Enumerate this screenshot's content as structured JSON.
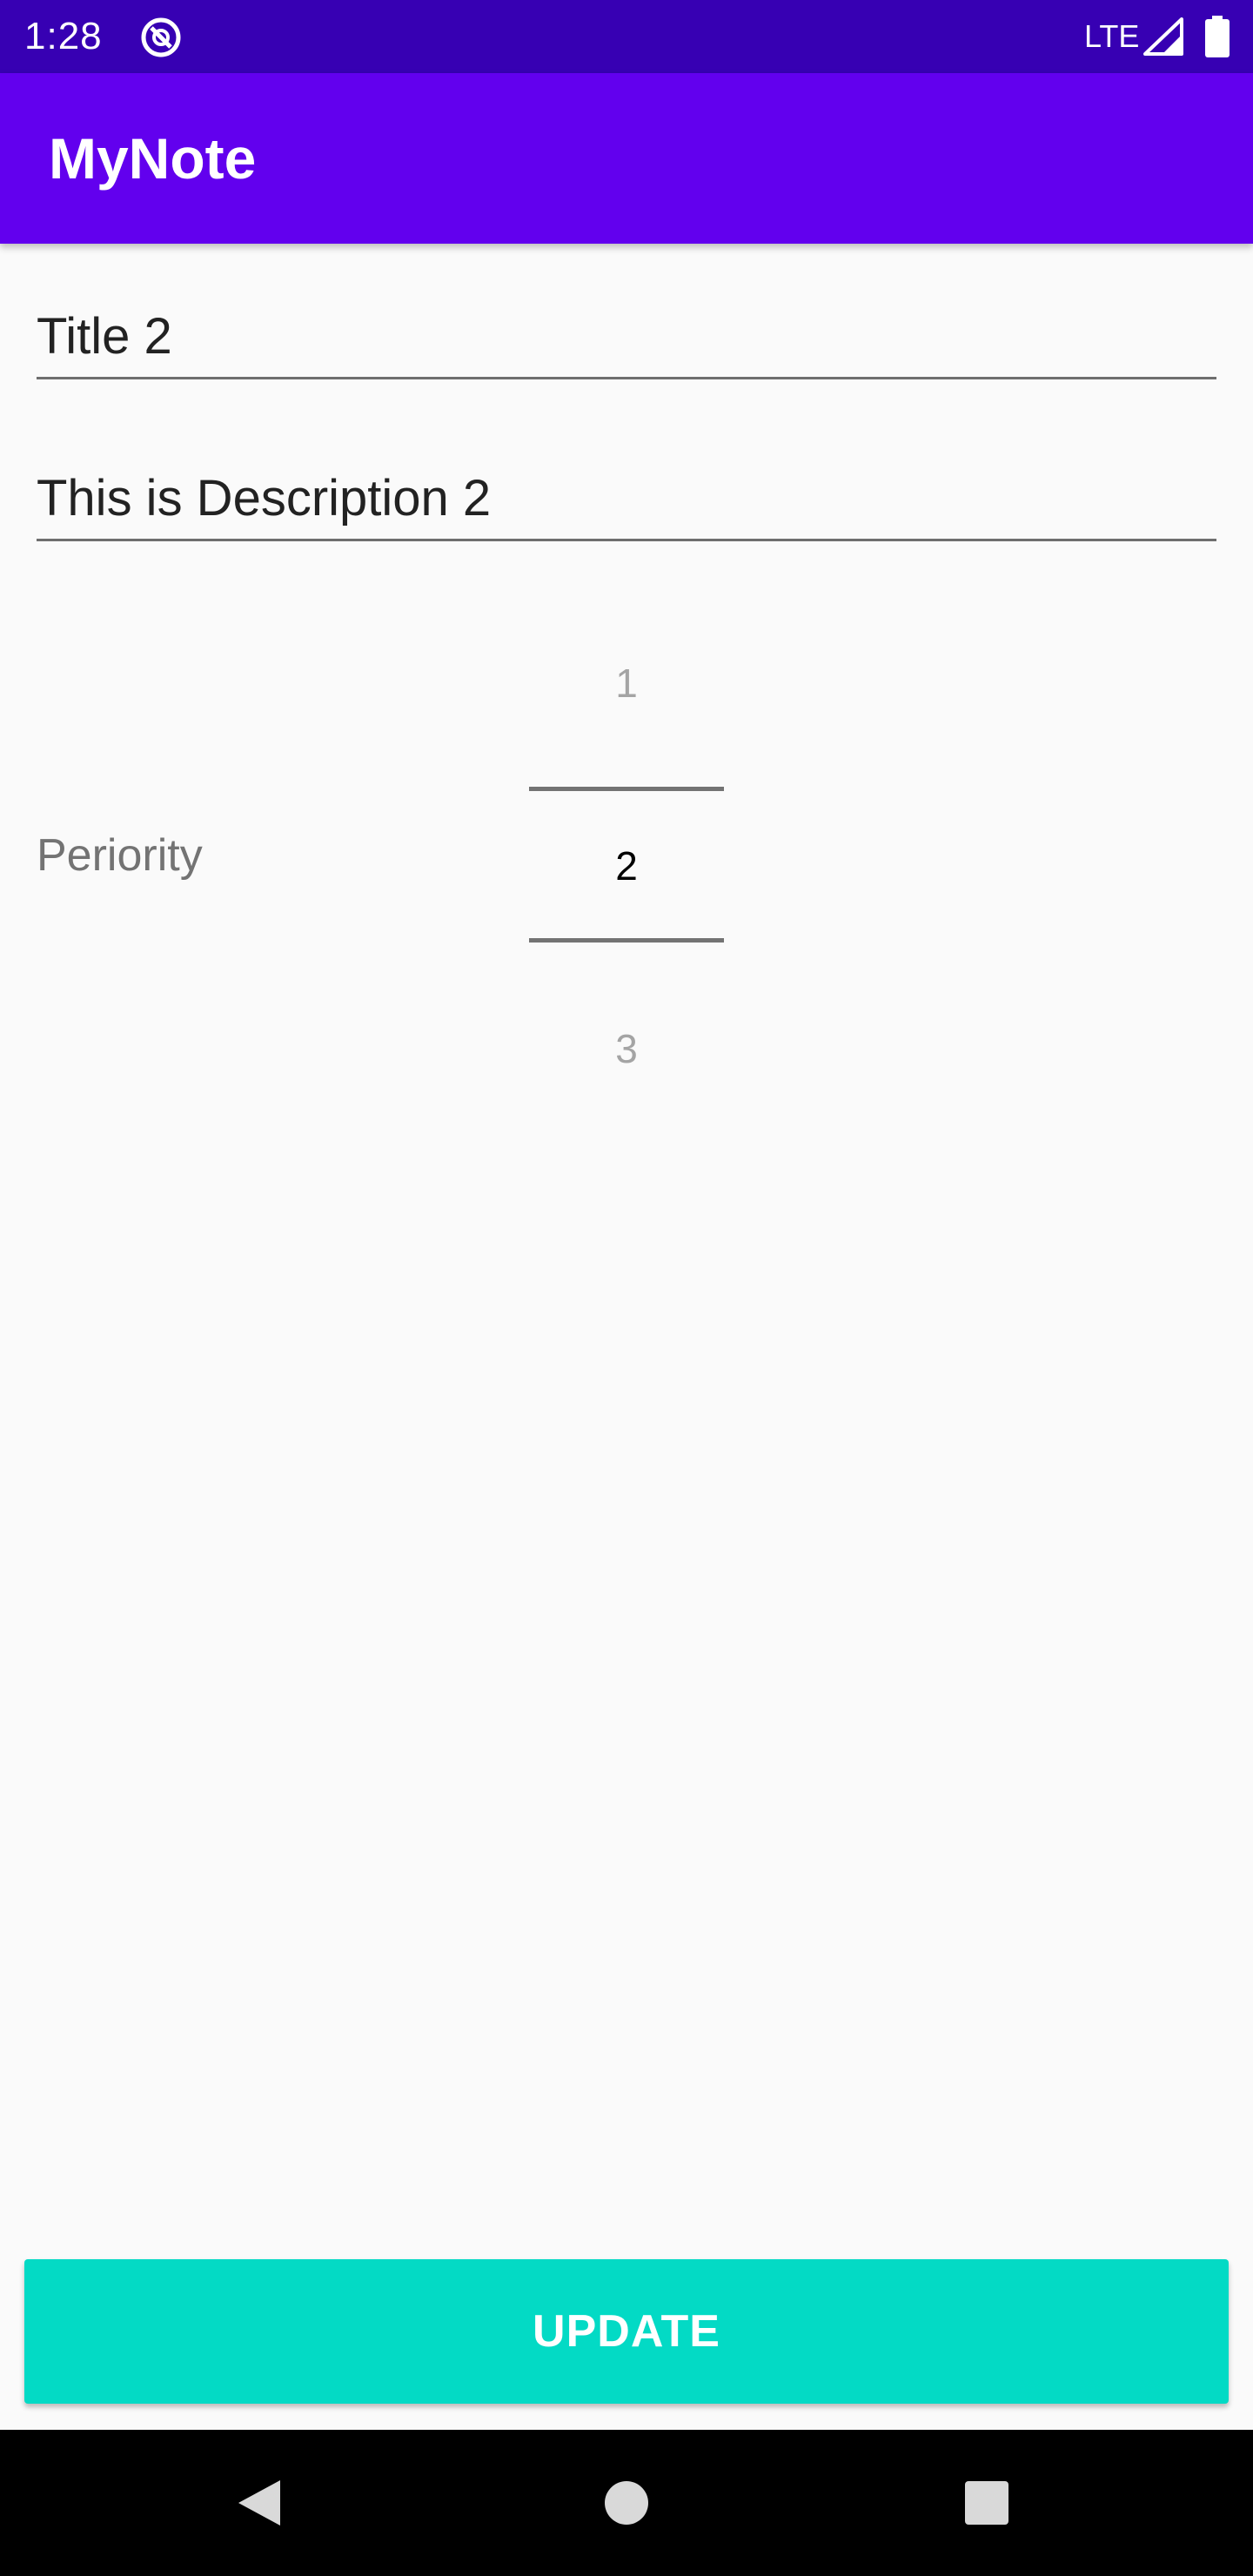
{
  "status_bar": {
    "time": "1:28",
    "network": "LTE",
    "icons": [
      "app-notification-icon",
      "signal-icon",
      "battery-icon"
    ]
  },
  "app_bar": {
    "title": "MyNote"
  },
  "form": {
    "title_value": "Title 2",
    "description_value": "This is Description 2",
    "priority_label": "Periority",
    "priority_picker": {
      "previous": "1",
      "current": "2",
      "next": "3"
    }
  },
  "update_button": {
    "label": "UPDATE"
  },
  "nav_bar": {
    "icons": [
      "back-icon",
      "home-icon",
      "recents-icon"
    ]
  },
  "colors": {
    "status_bar": "#3700b3",
    "app_bar": "#6200ee",
    "accent": "#03dac5",
    "background": "#fafafa",
    "nav_bar": "#000000"
  }
}
